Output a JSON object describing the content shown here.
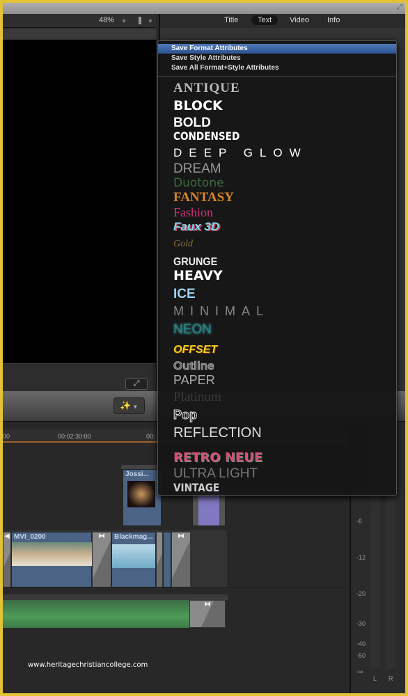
{
  "viewer": {
    "zoom": "48%"
  },
  "inspector": {
    "tabs": [
      {
        "label": "Title"
      },
      {
        "label": "Text",
        "selected": true
      },
      {
        "label": "Video"
      },
      {
        "label": "Info"
      }
    ]
  },
  "menu": {
    "actions": [
      "Save Format Attributes",
      "Save Style Attributes",
      "Save All Format+Style Attributes"
    ],
    "highlighted": "Save Format Attributes",
    "styles": [
      "ANTIQUE",
      "BLOCK",
      "BOLD",
      "CONDENSED",
      "DEEP GLOW",
      "DREAM",
      "Duotone",
      "FANTASY",
      "Fashion",
      "Faux 3D",
      "Gold",
      "GRUNGE",
      "HEAVY",
      "ICE",
      "MINIMAL",
      "NEON",
      "OFFSET",
      "Outline",
      "PAPER",
      "Platinum",
      "Pop",
      "REFLECTION",
      "RETRO NEUE",
      "ULTRA LIGHT",
      "VINTAGE"
    ]
  },
  "timeline": {
    "ruler": [
      "00",
      "00:02:30:00",
      "00:"
    ],
    "clips": {
      "connected": "Jossi...",
      "primary1": "MVI_0200",
      "primary2": "Blackmag..."
    }
  },
  "meter": {
    "labels": [
      "-6",
      "-12",
      "-20",
      "-30",
      "-40",
      "-50",
      "-∞"
    ],
    "channels": [
      "L",
      "R"
    ]
  },
  "watermark": "www.heritagechristiancollege.com",
  "colors": {
    "border": "#e3c236",
    "highlight": "#3a64a8",
    "clip": "#4b6485",
    "audio": "#3f7a48"
  }
}
